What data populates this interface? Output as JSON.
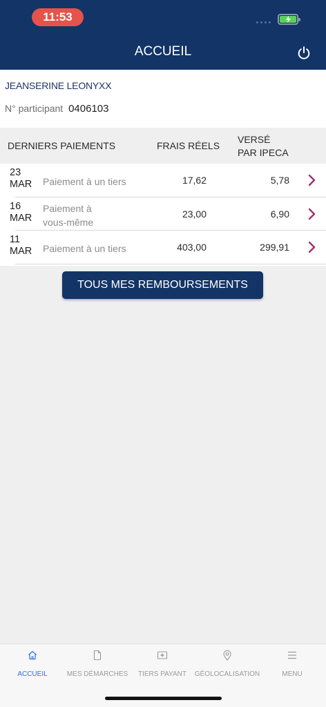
{
  "status_bar": {
    "time": "11:53"
  },
  "header": {
    "title": "ACCUEIL",
    "power_icon": "power-icon"
  },
  "user": {
    "name": "JEANSERINE LEONYXX",
    "participant_label": "N° participant",
    "participant_number": "0406103"
  },
  "payments": {
    "col_payments": "DERNIERS PAIEMENTS",
    "col_frais": "FRAIS RÉELS",
    "col_verse_line1": "VERSÉ",
    "col_verse_line2": "PAR IPECA",
    "rows": [
      {
        "day": "23",
        "month": "MAR",
        "label": "Paiement à un tiers",
        "frais": "17,62",
        "verse": "5,78"
      },
      {
        "day": "16",
        "month": "MAR",
        "label_line1": "Paiement à",
        "label_line2": "vous-même",
        "frais": "23,00",
        "verse": "6,90"
      },
      {
        "day": "11",
        "month": "MAR",
        "label": "Paiement à un tiers",
        "frais": "403,00",
        "verse": "299,91"
      }
    ]
  },
  "button_all": "TOUS MES REMBOURSEMENTS",
  "tabs": [
    {
      "label": "ACCUEIL",
      "icon": "home-icon"
    },
    {
      "label": "MES DÉMARCHES",
      "icon": "document-icon"
    },
    {
      "label": "TIERS PAYANT",
      "icon": "card-icon"
    },
    {
      "label": "GÉOLOCALISATION",
      "icon": "location-pin-icon"
    },
    {
      "label": "MENU",
      "icon": "hamburger-menu-icon"
    }
  ],
  "colors": {
    "primary": "#133466",
    "accent_chevron": "#a0306c",
    "active_tab": "#2f6fe0",
    "time_pill": "#e5534b"
  }
}
